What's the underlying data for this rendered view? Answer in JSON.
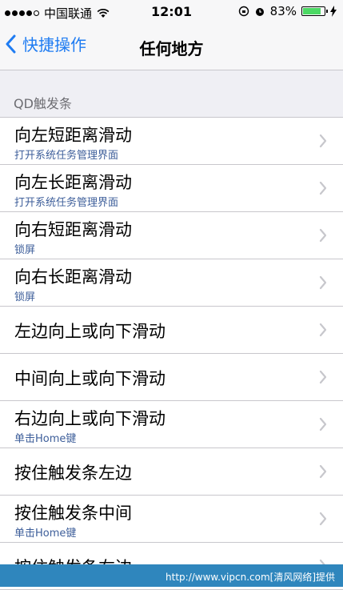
{
  "status_bar": {
    "carrier": "中国联通",
    "time": "12:01",
    "battery_percent": "83%",
    "battery_level": 0.83,
    "signal_bars": 4
  },
  "nav": {
    "back_label": "快捷操作",
    "title": "任何地方"
  },
  "section": {
    "header": "QD触发条"
  },
  "rows": [
    {
      "title": "向左短距离滑动",
      "subtitle": "打开系统任务管理界面"
    },
    {
      "title": "向左长距离滑动",
      "subtitle": "打开系统任务管理界面"
    },
    {
      "title": "向右短距离滑动",
      "subtitle": "锁屏"
    },
    {
      "title": "向右长距离滑动",
      "subtitle": "锁屏"
    },
    {
      "title": "左边向上或向下滑动",
      "subtitle": ""
    },
    {
      "title": "中间向上或向下滑动",
      "subtitle": ""
    },
    {
      "title": "右边向上或向下滑动",
      "subtitle": "单击Home键"
    },
    {
      "title": "按住触发条左边",
      "subtitle": ""
    },
    {
      "title": "按住触发条中间",
      "subtitle": "单击Home键"
    },
    {
      "title": "按住触发条右边",
      "subtitle": ""
    }
  ],
  "watermark": "http://www.vipcn.com[清风网络]提供",
  "colors": {
    "accent": "#1f7cf2",
    "subtitle": "#3d5e9a",
    "watermark_bg": "#2f86bd",
    "battery": "#4cd964"
  }
}
